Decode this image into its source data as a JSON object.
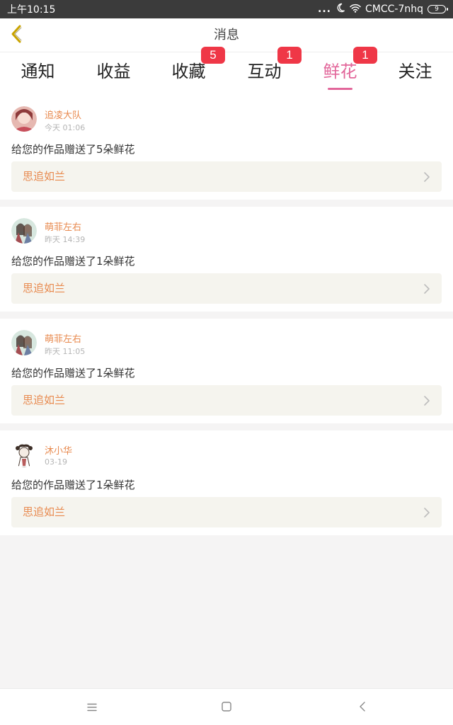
{
  "status_bar": {
    "time": "上午10:15",
    "signal_dots": "...",
    "network": "CMCC-7nhq",
    "battery": "9"
  },
  "header": {
    "title": "消息",
    "back_icon": "chevron-left-icon"
  },
  "tabs": [
    {
      "label": "通知",
      "badge": ""
    },
    {
      "label": "收益",
      "badge": ""
    },
    {
      "label": "收藏",
      "badge": "5"
    },
    {
      "label": "互动",
      "badge": "1"
    },
    {
      "label": "鲜花",
      "badge": "1",
      "active": true
    },
    {
      "label": "关注",
      "badge": ""
    }
  ],
  "messages": [
    {
      "user": "追凌大队",
      "time": "今天 01:06",
      "text": "给您的作品赠送了5朵鲜花",
      "work": "思追如兰"
    },
    {
      "user": "萌菲左右",
      "time": "昨天 14:39",
      "text": "给您的作品赠送了1朵鲜花",
      "work": "思追如兰"
    },
    {
      "user": "萌菲左右",
      "time": "昨天 11:05",
      "text": "给您的作品赠送了1朵鲜花",
      "work": "思追如兰"
    },
    {
      "user": "沐小华",
      "time": "03-19",
      "text": "给您的作品赠送了1朵鲜花",
      "work": "思追如兰"
    }
  ],
  "colors": {
    "accent": "#e2669a",
    "badge": "#ef3747",
    "username": "#e88a4f",
    "link_bg": "#f5f4ee",
    "back_icon": "#c9a300"
  },
  "nav_bar": {
    "icons": [
      "menu-icon",
      "home-icon",
      "back-icon"
    ]
  }
}
